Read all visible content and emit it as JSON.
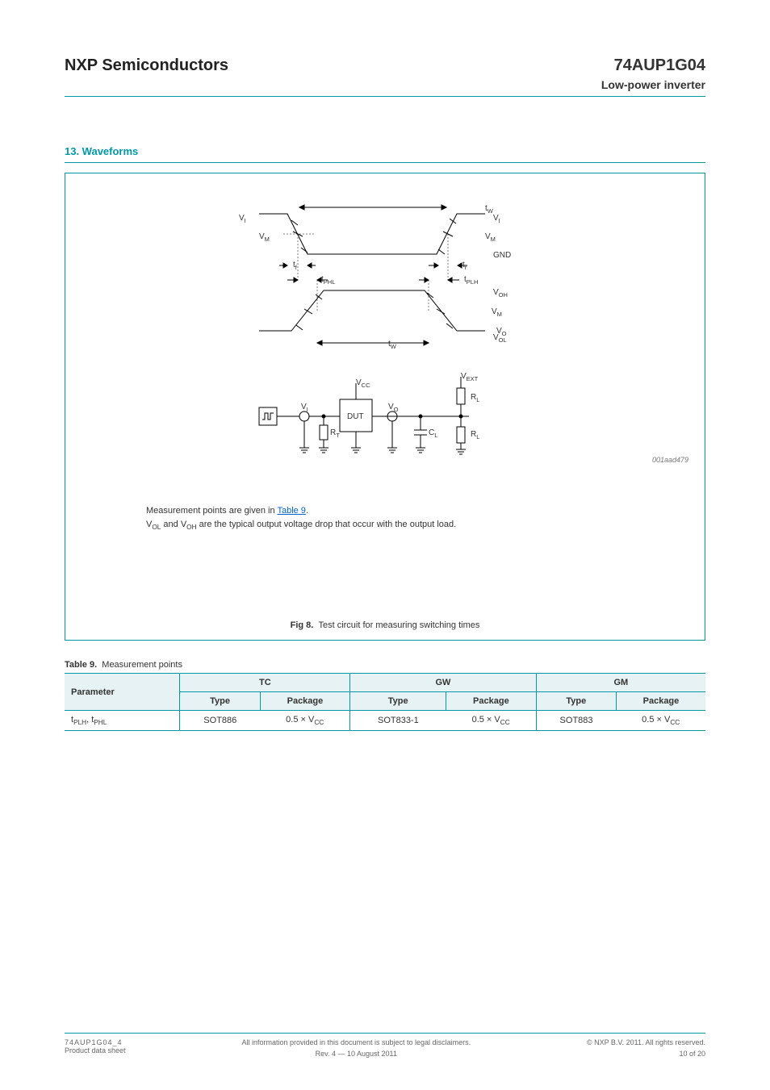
{
  "header": {
    "company": "NXP Semiconductors",
    "product": "74AUP1G04",
    "subtitle": "Low-power inverter"
  },
  "section": {
    "title": "13. Waveforms"
  },
  "figure": {
    "labels": {
      "vi": "V",
      "vi_sub": "I",
      "vo": "V",
      "vo_sub": "O",
      "gnd1": "GND",
      "gnd2": "GND",
      "vm1": "V",
      "vm1_sub": "M",
      "vm2": "V",
      "vm2_sub": "M",
      "tphl": "t",
      "tphl_sub": "PHL",
      "tplh": "t",
      "tplh_sub": "PLH",
      "tw": "t",
      "tw_sub": "W",
      "tf": "t",
      "tf_sub": "f",
      "tr": "t",
      "tr_sub": "r",
      "vcc": "V",
      "vcc_sub": "CC",
      "rl": "R",
      "rl_sub": "L",
      "vext": "V",
      "vext_sub": "EXT",
      "rt": "R",
      "rt_sub": "T",
      "cl": "C",
      "cl_sub": "L",
      "dut": "DUT",
      "diagram_id": "001aad479"
    },
    "note_prefix": "Measurement points are given in ",
    "note_link": "Table 9",
    "note_suffix": ".",
    "note_vol": "V",
    "note_vol_sub": "OL",
    "note_vol_text": " and V",
    "note_voh_sub": "OH",
    "note_rest": " are the typical output voltage drop that occur with the output load.",
    "caption_num": "Fig 8.",
    "caption_text": "Test circuit for measuring switching times"
  },
  "table": {
    "caption_num": "Table 9.",
    "caption_text": "Measurement points",
    "header_param": "Parameter",
    "type_cols": [
      "TC",
      "GW",
      "GM"
    ],
    "sub_cols": [
      "Type",
      "Package"
    ],
    "row": {
      "param": "t",
      "param_sub": "PLH",
      "param2": ", t",
      "param_sub2": "PHL",
      "tc_type": "SOT886",
      "tc_pkg": "0.5 × V",
      "tc_pkg_sub": "CC",
      "gw_type": "SOT833-1",
      "gw_pkg": "0.5 × V",
      "gw_pkg_sub": "CC",
      "gm_type": "SOT883",
      "gm_pkg": "0.5 × V",
      "gm_pkg_sub": "CC"
    }
  },
  "footer": {
    "left_id": "74AUP1G04_4",
    "left_sub": "Product data sheet",
    "center": "All information provided in this document is subject to legal disclaimers.",
    "right_top": "© NXP B.V. 2011. All rights reserved.",
    "right_rev": "Rev. 4 — 10 August 2011",
    "page": "10 of 20"
  }
}
